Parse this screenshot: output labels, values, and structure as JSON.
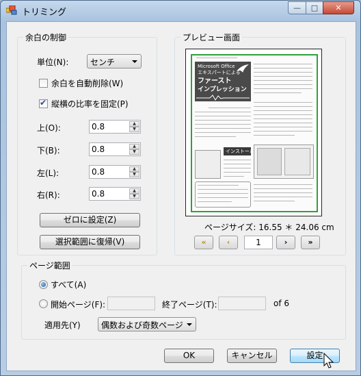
{
  "window": {
    "title": "トリミング",
    "minimize_glyph": "—",
    "maximize_glyph": "□",
    "close_glyph": "✕"
  },
  "margin_group": {
    "title": "余白の制御",
    "unit_label": "単位(N):",
    "unit_value": "センチ",
    "auto_remove_label": "余白を自動削除(W)",
    "auto_remove_checked": false,
    "fix_aspect_label": "縦横の比率を固定(P)",
    "fix_aspect_checked": true,
    "top_label": "上(O):",
    "top_value": "0.8",
    "bottom_label": "下(B):",
    "bottom_value": "0.8",
    "left_label": "左(L):",
    "left_value": "0.8",
    "right_label": "右(R):",
    "right_value": "0.8",
    "zero_button": "ゼロに設定(Z)",
    "restore_button": "選択範囲に復帰(V)"
  },
  "preview_group": {
    "title": "プレビュー画面",
    "page_size": "ページサイズ: 16.55 ＊ 24.06 cm",
    "page_number": "1",
    "first_glyph": "«",
    "prev_glyph": "‹",
    "next_glyph": "›",
    "last_glyph": "»",
    "thumbnail": {
      "header_line1": "Microsoft Office",
      "header_line2": "エキスパートによる",
      "header_line3": "ファースト",
      "header_line4": "インプレッション",
      "section_title": "インストール",
      "colors": {
        "page_border": "#2ea03a",
        "header_bg": "#4a4a4a"
      }
    }
  },
  "page_range_group": {
    "title": "ページ範囲",
    "all_label": "すべて(A)",
    "all_selected": true,
    "start_label": "開始ページ(F):",
    "end_label": "終了ページ(T):",
    "of_label": "of 6",
    "apply_label": "適用先(Y)",
    "apply_value": "偶数および奇数ページ"
  },
  "footer": {
    "ok_button": "OK",
    "cancel_button": "キャンセル",
    "settings_button": "設定"
  }
}
